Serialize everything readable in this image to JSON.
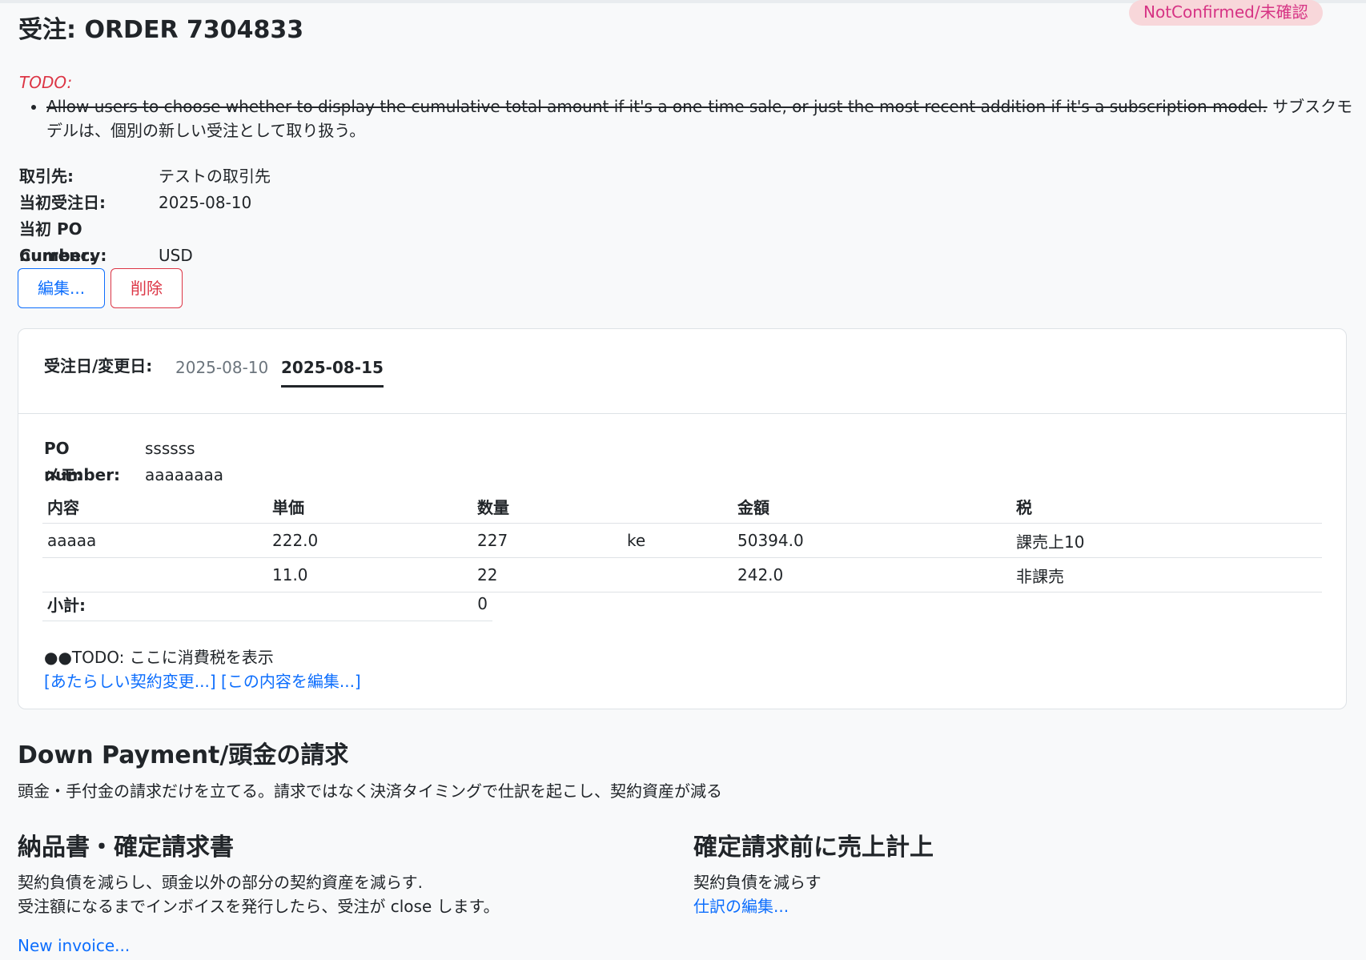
{
  "header": {
    "title": "受注: ORDER 7304833",
    "status_badge": "NotConfirmed/未確認"
  },
  "todo": {
    "label": "TODO:",
    "item_strike": "Allow users to choose whether to display the cumulative total amount if it's a one-time sale, or just the most recent addition if it's a subscription model.",
    "item_text": " サブスクモデルは、個別の新しい受注として取り扱う。"
  },
  "info": {
    "client_label": "取引先:",
    "client_value": "テストの取引先",
    "date_label": "当初受注日:",
    "date_value": "2025-08-10",
    "po_label": "当初 PO number:",
    "po_value": "",
    "currency_label": "Currency:",
    "currency_value": "USD"
  },
  "actions": {
    "edit": "編集...",
    "delete": "削除"
  },
  "revisions": {
    "label": "受注日/変更日:",
    "tabs": [
      "2025-08-10",
      "2025-08-15"
    ],
    "active_index": 1
  },
  "revision": {
    "po_label": "PO number:",
    "po_value": "ssssss",
    "memo_label": "メモ:",
    "memo_value": "aaaaaaaa",
    "columns": [
      "内容",
      "単価",
      "数量",
      "",
      "金額",
      "税"
    ],
    "rows": [
      [
        "aaaaa",
        "222.0",
        "227",
        "ke",
        "50394.0",
        "課売上10"
      ],
      [
        "",
        "11.0",
        "22",
        "",
        "242.0",
        "非課売"
      ]
    ],
    "subtotal_label": "小計:",
    "subtotal_value": "0",
    "todo_note": "●●TODO: ここに消費税を表示",
    "link_new_change": "[あたらしい契約変更...]",
    "link_edit": "[この内容を編集...]"
  },
  "down_payment": {
    "title": "Down Payment/頭金の請求",
    "desc": "頭金・手付金の請求だけを立てる。請求ではなく決済タイミングで仕訳を起こし、契約資産が減る"
  },
  "invoice": {
    "title": "納品書・確定請求書",
    "desc1": "契約負債を減らし、頭金以外の部分の契約資産を減らす.",
    "desc2": "受注額になるまでインボイスを発行したら、受注が close します。",
    "link_new": "New invoice..."
  },
  "revenue": {
    "title": "確定請求前に売上計上",
    "desc": "契約負債を減らす",
    "link_journal": "仕訳の編集..."
  }
}
